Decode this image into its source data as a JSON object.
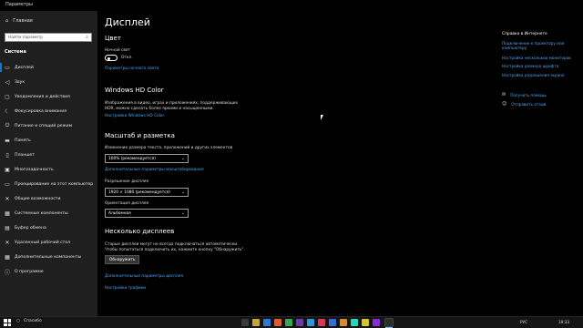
{
  "window": {
    "title": "Параметры"
  },
  "sidebar": {
    "home_label": "Главная",
    "search_placeholder": "Найти параметр",
    "section_label": "Система",
    "items": [
      {
        "label": "Дисплей",
        "icon": "monitor-icon",
        "active": true
      },
      {
        "label": "Звук",
        "icon": "speaker-icon"
      },
      {
        "label": "Уведомления и действия",
        "icon": "notification-icon"
      },
      {
        "label": "Фокусировка внимания",
        "icon": "moon-icon"
      },
      {
        "label": "Питание и спящий режим",
        "icon": "power-icon"
      },
      {
        "label": "Память",
        "icon": "storage-icon"
      },
      {
        "label": "Планшет",
        "icon": "tablet-icon"
      },
      {
        "label": "Многозадачность",
        "icon": "multitask-icon"
      },
      {
        "label": "Проецирование на этот компьютер",
        "icon": "projector-icon"
      },
      {
        "label": "Общие возможности",
        "icon": "share-icon"
      },
      {
        "label": "Системные компоненты",
        "icon": "components-icon"
      },
      {
        "label": "Буфер обмена",
        "icon": "clipboard-icon"
      },
      {
        "label": "Удаленный рабочий стол",
        "icon": "remote-desktop-icon"
      },
      {
        "label": "Дополнительные компоненты",
        "icon": "extra-components-icon"
      },
      {
        "label": "О программе",
        "icon": "info-icon"
      }
    ]
  },
  "main": {
    "title": "Дисплей",
    "color_heading": "Цвет",
    "night_light_label": "Ночной свет",
    "night_light_state": "Откл.",
    "night_light_link": "Параметры ночного света",
    "hdr_heading": "Windows HD Color",
    "hdr_desc_line1": "Изображения в видео, играх и приложениях, поддерживающих",
    "hdr_desc_line2": "HDR, можно сделать более яркими и насыщенными.",
    "hdr_link": "Настройки Windows HD Color",
    "scale_heading": "Масштаб и разметка",
    "scale_label": "Изменение размера текста, приложений и других элементов",
    "scale_value": "100% (рекомендуется)",
    "scale_link": "Дополнительные параметры масштабирования",
    "resolution_label": "Разрешение дисплея",
    "resolution_value": "1920 × 1080 (рекомендуется)",
    "orientation_label": "Ориентация дисплея",
    "orientation_value": "Альбомная",
    "multi_heading": "Несколько дисплеев",
    "multi_desc_line1": "Старые дисплеи могут не всегда подключаться автоматически.",
    "multi_desc_line2": "Чтобы попытаться подключить их, нажмите кнопку \"Обнаружить\".",
    "detect_button": "Обнаружить",
    "advanced_link": "Дополнительные параметры дисплея",
    "graphics_link": "Настройки графики"
  },
  "related": {
    "title": "Справка в Интернете",
    "links": [
      "Подключение к проектору или компьютеру",
      "Настройка нескольких мониторов",
      "Настройка размера шрифта",
      "Настройка разрешения экрана"
    ],
    "help": [
      {
        "label": "Получить помощь",
        "icon": "help-chat-icon"
      },
      {
        "label": "Отправить отзыв",
        "icon": "feedback-icon"
      }
    ]
  },
  "taskbar": {
    "search_label": "Спасибо",
    "lang": "РУС",
    "time": "19:33"
  }
}
